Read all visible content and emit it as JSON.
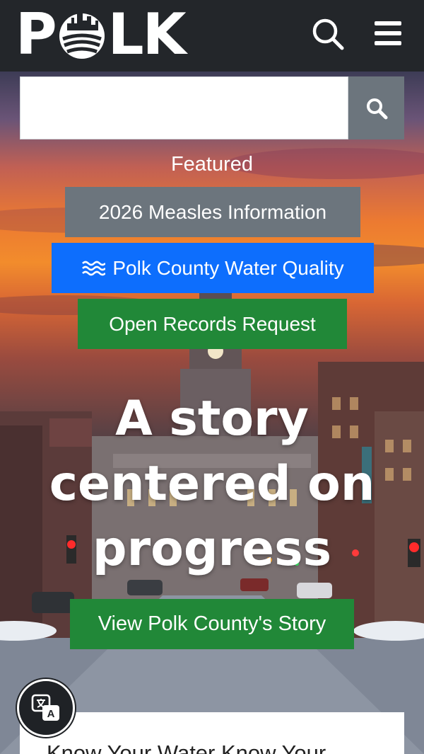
{
  "header": {
    "logo_text_left": "P",
    "logo_text_right": "LK",
    "logo_alt": "POLK",
    "search_icon": "search-icon",
    "menu_icon": "hamburger-menu-icon",
    "background_color": "#23262a"
  },
  "search": {
    "placeholder": "",
    "value": "",
    "button_icon": "search-icon",
    "button_color": "#6c757d"
  },
  "featured": {
    "label": "Featured",
    "items": [
      {
        "label": "2026 Measles Information",
        "color": "#6c757d"
      },
      {
        "label": "Polk County Water Quality",
        "icon": "water-waves-icon",
        "color": "#0d6efd"
      },
      {
        "label": "Open Records Request",
        "color": "#218838"
      }
    ]
  },
  "hero": {
    "headline": "A story centered on progress",
    "cta_label": "View Polk County's Story",
    "cta_color": "#218838"
  },
  "translate": {
    "icon": "translate-icon"
  },
  "card": {
    "title": "Know Your Water Know Your"
  }
}
